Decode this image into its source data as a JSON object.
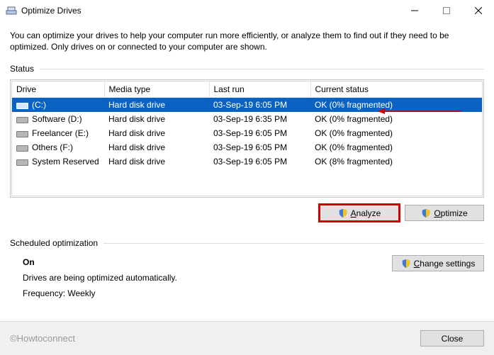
{
  "window": {
    "title": "Optimize Drives",
    "intro": "You can optimize your drives to help your computer run more efficiently, or analyze them to find out if they need to be optimized. Only drives on or connected to your computer are shown."
  },
  "status": {
    "label": "Status",
    "columns": {
      "drive": "Drive",
      "media": "Media type",
      "last": "Last run",
      "status": "Current status"
    },
    "rows": [
      {
        "drive": "(C:)",
        "media": "Hard disk drive",
        "last": "03-Sep-19 6:05 PM",
        "status": "OK (0% fragmented)",
        "selected": true
      },
      {
        "drive": "Software (D:)",
        "media": "Hard disk drive",
        "last": "03-Sep-19 6:35 PM",
        "status": "OK (0% fragmented)",
        "selected": false
      },
      {
        "drive": "Freelancer (E:)",
        "media": "Hard disk drive",
        "last": "03-Sep-19 6:05 PM",
        "status": "OK (0% fragmented)",
        "selected": false
      },
      {
        "drive": "Others (F:)",
        "media": "Hard disk drive",
        "last": "03-Sep-19 6:05 PM",
        "status": "OK (0% fragmented)",
        "selected": false
      },
      {
        "drive": "System Reserved",
        "media": "Hard disk drive",
        "last": "03-Sep-19 6:05 PM",
        "status": "OK (8% fragmented)",
        "selected": false
      }
    ]
  },
  "buttons": {
    "analyze_prefix": "A",
    "analyze_rest": "nalyze",
    "optimize_prefix": "O",
    "optimize_rest": "ptimize",
    "change_prefix": "C",
    "change_rest": "hange settings",
    "close": "Close"
  },
  "sched": {
    "label": "Scheduled optimization",
    "on": "On",
    "desc": "Drives are being optimized automatically.",
    "freq": "Frequency: Weekly"
  },
  "watermark": "©Howtoconnect"
}
